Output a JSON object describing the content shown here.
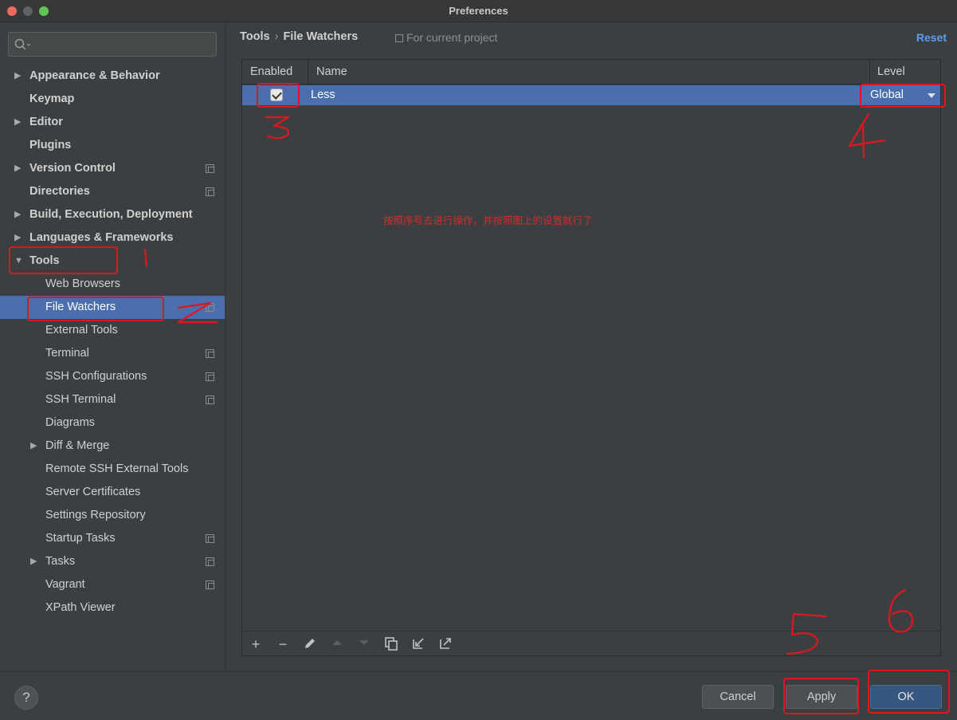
{
  "window": {
    "title": "Preferences"
  },
  "search": {
    "placeholder": "",
    "icon": "search-icon"
  },
  "sidebar": {
    "items": [
      {
        "label": "Appearance & Behavior",
        "expandable": true,
        "bold": true
      },
      {
        "label": "Keymap",
        "bold": true
      },
      {
        "label": "Editor",
        "expandable": true,
        "bold": true
      },
      {
        "label": "Plugins",
        "bold": true
      },
      {
        "label": "Version Control",
        "expandable": true,
        "bold": true,
        "project": true
      },
      {
        "label": "Directories",
        "bold": true,
        "project": true
      },
      {
        "label": "Build, Execution, Deployment",
        "expandable": true,
        "bold": true
      },
      {
        "label": "Languages & Frameworks",
        "expandable": true,
        "bold": true
      },
      {
        "label": "Tools",
        "expanded": true,
        "bold": true
      },
      {
        "label": "Web Browsers",
        "sub": true
      },
      {
        "label": "File Watchers",
        "sub": true,
        "selected": true,
        "project": true
      },
      {
        "label": "External Tools",
        "sub": true
      },
      {
        "label": "Terminal",
        "sub": true,
        "project": true
      },
      {
        "label": "SSH Configurations",
        "sub": true,
        "project": true
      },
      {
        "label": "SSH Terminal",
        "sub": true,
        "project": true
      },
      {
        "label": "Diagrams",
        "sub": true
      },
      {
        "label": "Diff & Merge",
        "sub": true,
        "expandable": true
      },
      {
        "label": "Remote SSH External Tools",
        "sub": true
      },
      {
        "label": "Server Certificates",
        "sub": true
      },
      {
        "label": "Settings Repository",
        "sub": true
      },
      {
        "label": "Startup Tasks",
        "sub": true,
        "project": true
      },
      {
        "label": "Tasks",
        "sub": true,
        "expandable": true,
        "project": true
      },
      {
        "label": "Vagrant",
        "sub": true,
        "project": true
      },
      {
        "label": "XPath Viewer",
        "sub": true
      }
    ]
  },
  "header": {
    "crumb_root": "Tools",
    "crumb_sep": "›",
    "crumb_current": "File Watchers",
    "project_note": "For current project",
    "reset": "Reset"
  },
  "table": {
    "columns": {
      "enabled": "Enabled",
      "name": "Name",
      "level": "Level"
    },
    "rows": [
      {
        "enabled": true,
        "name": "Less",
        "level": "Global"
      }
    ]
  },
  "toolbar": {
    "add": "+",
    "remove": "−",
    "edit": "edit-icon",
    "up": "move-up-icon",
    "down": "move-down-icon",
    "copy": "copy-icon",
    "import": "import-icon",
    "export": "export-icon"
  },
  "instruction": "按照序号去进行操作，并按照图上的设置就行了",
  "footer": {
    "help": "?",
    "cancel": "Cancel",
    "apply": "Apply",
    "ok": "OK"
  },
  "annotations": {
    "color": "#e0161f",
    "numbers": [
      "1",
      "2",
      "3",
      "4",
      "5",
      "6"
    ]
  },
  "colors": {
    "selection": "#4b6eaf",
    "link": "#589df6",
    "ok_button": "#365880"
  }
}
